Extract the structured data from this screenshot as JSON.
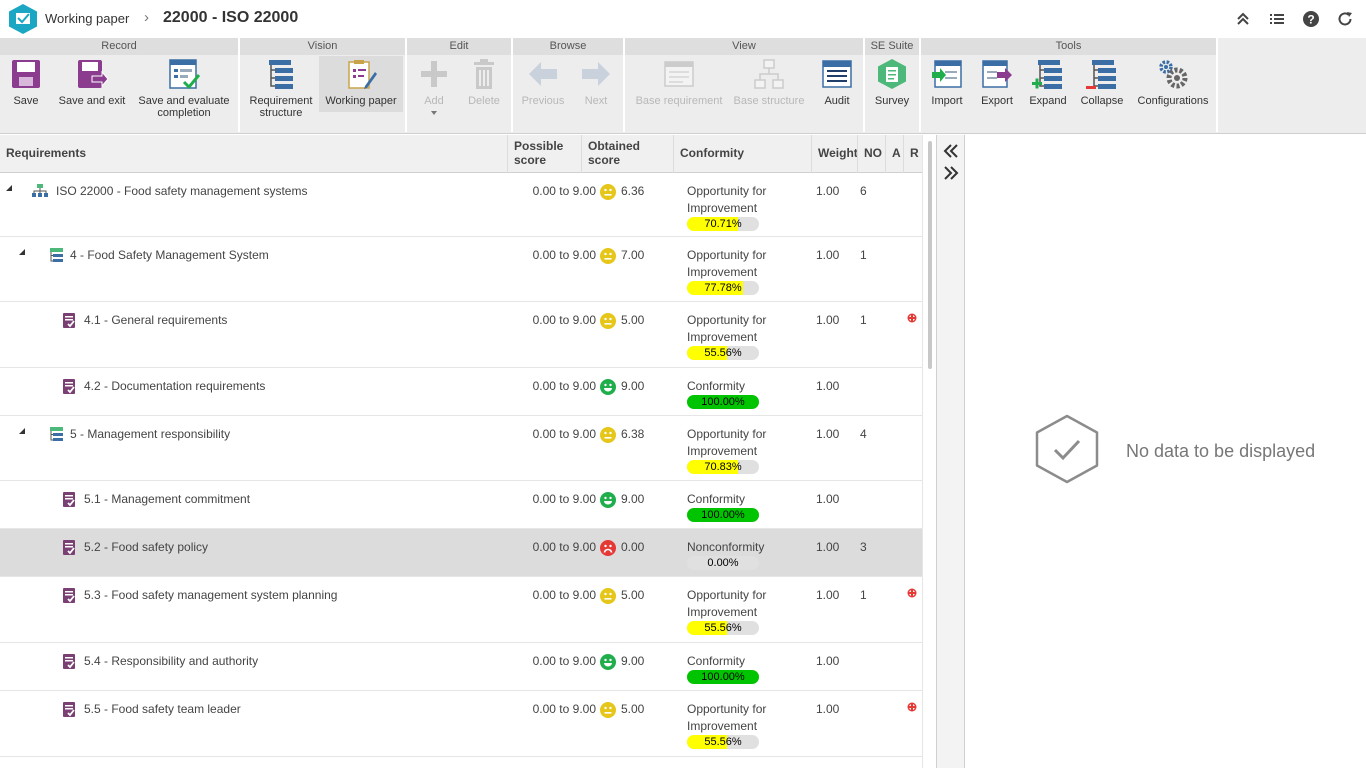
{
  "header": {
    "breadcrumb_root": "Working paper",
    "breadcrumb_sep": "›",
    "title": "22000 - ISO 22000",
    "icons": [
      "collapse-up-icon",
      "list-icon",
      "help-icon",
      "refresh-icon"
    ]
  },
  "ribbon": {
    "groups": {
      "record": "Record",
      "vision": "Vision",
      "edit": "Edit",
      "browse": "Browse",
      "view": "View",
      "se_suite": "SE Suite",
      "tools": "Tools"
    },
    "buttons": {
      "save": "Save",
      "save_exit": "Save and exit",
      "save_eval_1": "Save and evaluate",
      "save_eval_2": "completion",
      "req_struct_1": "Requirement",
      "req_struct_2": "structure",
      "working_paper": "Working paper",
      "add": "Add",
      "delete": "Delete",
      "previous": "Previous",
      "next": "Next",
      "base_requirement": "Base requirement",
      "base_structure": "Base structure",
      "audit": "Audit",
      "survey": "Survey",
      "import": "Import",
      "export": "Export",
      "expand": "Expand",
      "collapse": "Collapse",
      "configurations": "Configurations"
    }
  },
  "grid": {
    "columns": {
      "requirements": "Requirements",
      "possible_1": "Possible",
      "possible_2": "score",
      "obtained_1": "Obtained",
      "obtained_2": "score",
      "conformity": "Conformity",
      "weight": "Weight",
      "no": "NO",
      "a": "A",
      "r": "R"
    },
    "rows": [
      {
        "name": "ISO 22000 - Food safety management systems",
        "possible": "0.00 to 9.00",
        "obtained": "6.36",
        "face": "neutral",
        "conf1": "Opportunity for",
        "conf2": "Improvement",
        "pct": "70.71%",
        "pct_value": 70.71,
        "weight": "1.00",
        "no": "6",
        "r": false
      },
      {
        "name": "4 - Food Safety Management System",
        "possible": "0.00 to 9.00",
        "obtained": "7.00",
        "face": "neutral",
        "conf1": "Opportunity for",
        "conf2": "Improvement",
        "pct": "77.78%",
        "pct_value": 77.78,
        "weight": "1.00",
        "no": "1",
        "r": false
      },
      {
        "name": "4.1 - General requirements",
        "possible": "0.00 to 9.00",
        "obtained": "5.00",
        "face": "neutral",
        "conf1": "Opportunity for",
        "conf2": "Improvement",
        "pct": "55.56%",
        "pct_value": 55.56,
        "weight": "1.00",
        "no": "1",
        "r": true
      },
      {
        "name": "4.2 - Documentation requirements",
        "possible": "0.00 to 9.00",
        "obtained": "9.00",
        "face": "happy",
        "conf1": "Conformity",
        "conf2": "",
        "pct": "100.00%",
        "pct_value": 100,
        "weight": "1.00",
        "no": "",
        "r": false
      },
      {
        "name": "5 - Management responsibility",
        "possible": "0.00 to 9.00",
        "obtained": "6.38",
        "face": "neutral",
        "conf1": "Opportunity for",
        "conf2": "Improvement",
        "pct": "70.83%",
        "pct_value": 70.83,
        "weight": "1.00",
        "no": "4",
        "r": false
      },
      {
        "name": "5.1 - Management commitment",
        "possible": "0.00 to 9.00",
        "obtained": "9.00",
        "face": "happy",
        "conf1": "Conformity",
        "conf2": "",
        "pct": "100.00%",
        "pct_value": 100,
        "weight": "1.00",
        "no": "",
        "r": false
      },
      {
        "name": "5.2 - Food safety policy",
        "possible": "0.00 to 9.00",
        "obtained": "0.00",
        "face": "sad",
        "conf1": "Nonconformity",
        "conf2": "",
        "pct": "0.00%",
        "pct_value": 0,
        "weight": "1.00",
        "no": "3",
        "r": false
      },
      {
        "name": "5.3 - Food safety management system planning",
        "possible": "0.00 to 9.00",
        "obtained": "5.00",
        "face": "neutral",
        "conf1": "Opportunity for",
        "conf2": "Improvement",
        "pct": "55.56%",
        "pct_value": 55.56,
        "weight": "1.00",
        "no": "1",
        "r": true
      },
      {
        "name": "5.4 - Responsibility and authority",
        "possible": "0.00 to 9.00",
        "obtained": "9.00",
        "face": "happy",
        "conf1": "Conformity",
        "conf2": "",
        "pct": "100.00%",
        "pct_value": 100,
        "weight": "1.00",
        "no": "",
        "r": false
      },
      {
        "name": "5.5 - Food safety team leader",
        "possible": "0.00 to 9.00",
        "obtained": "5.00",
        "face": "neutral",
        "conf1": "Opportunity for",
        "conf2": "Improvement",
        "pct": "55.56%",
        "pct_value": 55.56,
        "weight": "1.00",
        "no": "",
        "r": true
      }
    ]
  },
  "side_panel": {
    "empty_text": "No data to be displayed"
  },
  "colors": {
    "partial": "#ffff00",
    "full": "#00c400",
    "face_neutral": "#e6c619",
    "face_happy": "#1fae4b",
    "face_sad": "#e53935"
  }
}
